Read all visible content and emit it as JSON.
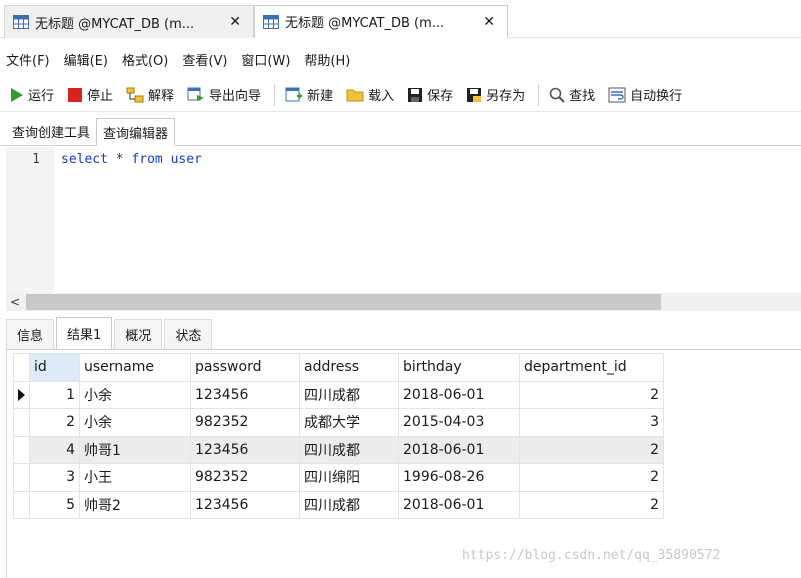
{
  "doc_tabs": [
    {
      "title": "无标题 @MYCAT_DB (m...",
      "close": "✕"
    },
    {
      "title": "无标题 @MYCAT_DB (m...",
      "close": "✕"
    }
  ],
  "menu": [
    "文件(F)",
    "编辑(E)",
    "格式(O)",
    "查看(V)",
    "窗口(W)",
    "帮助(H)"
  ],
  "toolbar": {
    "run": "运行",
    "stop": "停止",
    "explain": "解释",
    "export": "导出向导",
    "new": "新建",
    "load": "载入",
    "save": "保存",
    "save_as": "另存为",
    "find": "查找",
    "wrap": "自动换行"
  },
  "subtabs": [
    "查询创建工具",
    "查询编辑器"
  ],
  "editor": {
    "line_number": "1",
    "kw_select": "select",
    "star": " * ",
    "kw_from": "from",
    "table": " user"
  },
  "scroll_left": "<",
  "result_tabs": [
    "信息",
    "结果1",
    "概况",
    "状态"
  ],
  "grid": {
    "columns": [
      "id",
      "username",
      "password",
      "address",
      "birthday",
      "department_id"
    ],
    "rows": [
      [
        "1",
        "小余",
        "123456",
        "四川成都",
        "2018-06-01",
        "2"
      ],
      [
        "2",
        "小余",
        "982352",
        "成都大学",
        "2015-04-03",
        "3"
      ],
      [
        "4",
        "帅哥1",
        "123456",
        "四川成都",
        "2018-06-01",
        "2"
      ],
      [
        "3",
        "小王",
        "982352",
        "四川绵阳",
        "1996-08-26",
        "2"
      ],
      [
        "5",
        "帅哥2",
        "123456",
        "四川成都",
        "2018-06-01",
        "2"
      ]
    ]
  },
  "watermark": "https://blog.csdn.net/qq_35890572",
  "colors": {
    "keyword": "#1f39c9",
    "sorted_header": "#dcebf7",
    "selected_row": "#ececec",
    "run_green": "#2e9d2e",
    "stop_red": "#d8231f"
  }
}
